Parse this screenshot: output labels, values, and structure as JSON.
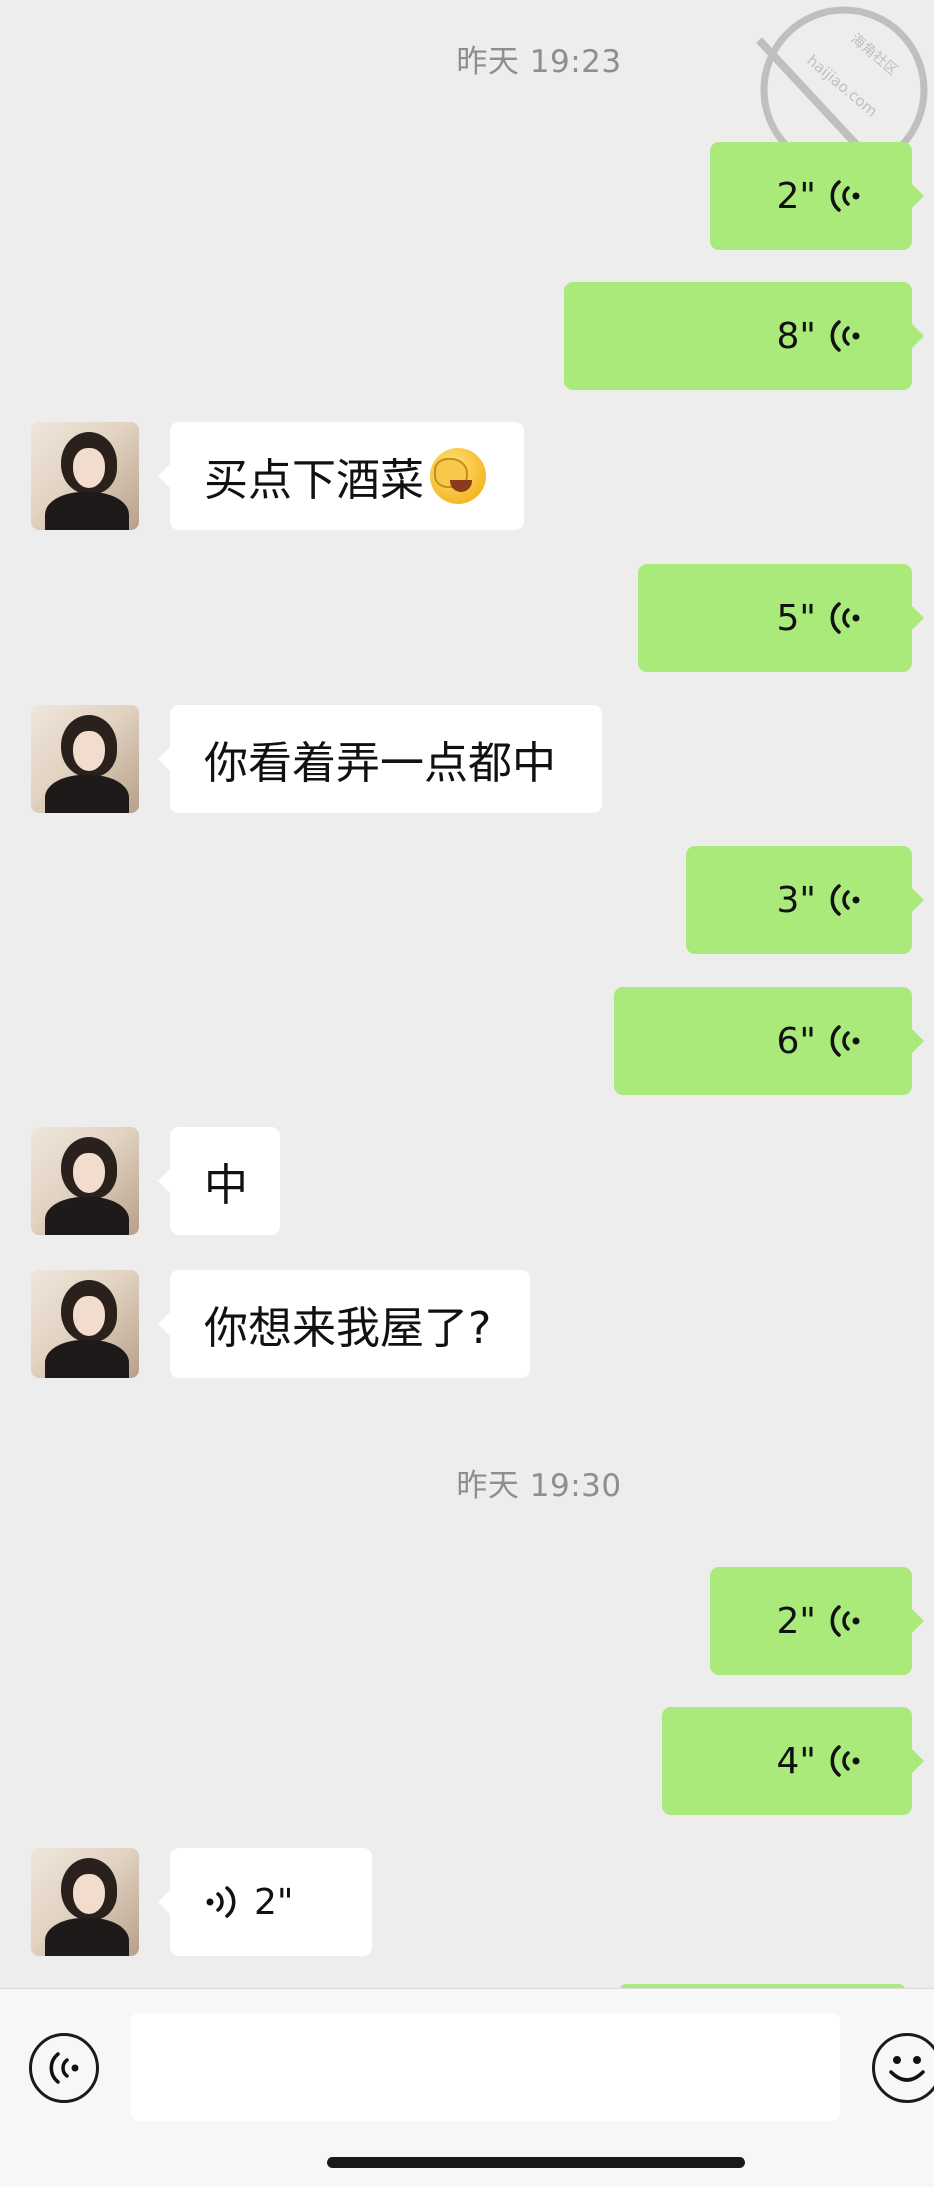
{
  "timestamps": [
    "昨天 19:23",
    "昨天 19:30"
  ],
  "messages": [
    {
      "side": "right",
      "duration": "2\""
    },
    {
      "side": "right",
      "duration": "8\""
    },
    {
      "side": "left",
      "text": "买点下酒菜",
      "emoji": "face-with-hand-emoji"
    },
    {
      "side": "right",
      "duration": "5\""
    },
    {
      "side": "left",
      "text": "你看着弄一点都中"
    },
    {
      "side": "right",
      "duration": "3\""
    },
    {
      "side": "right",
      "duration": "6\""
    },
    {
      "side": "left",
      "text": "中"
    },
    {
      "side": "left",
      "text": "你想来我屋了?"
    },
    {
      "side": "right",
      "duration": "2\""
    },
    {
      "side": "right",
      "duration": "4\""
    },
    {
      "side": "left",
      "duration": "2\""
    }
  ],
  "watermark": {
    "text": "海角社区 haijiao.com"
  },
  "input": {
    "placeholder": "",
    "voice_icon": "voice-input-icon",
    "emoji_icon": "emoji-icon"
  },
  "colors": {
    "background": "#ededed",
    "sent_bubble": "#a9ea7a",
    "received_bubble": "#ffffff",
    "timestamp": "#8e8e8e"
  }
}
